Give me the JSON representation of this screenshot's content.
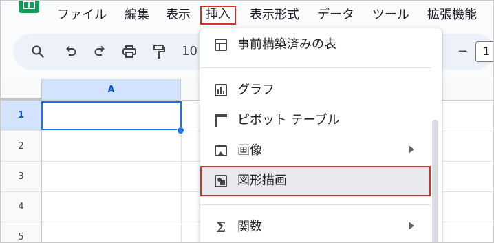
{
  "menubar": {
    "items": [
      "ファイル",
      "編集",
      "表示",
      "挿入",
      "表示形式",
      "データ",
      "ツール",
      "拡張機能"
    ],
    "active_index": 3
  },
  "toolbar": {
    "icons": [
      "search-icon",
      "undo-icon",
      "redo-icon",
      "print-icon",
      "paint-format-icon"
    ],
    "zoom_text": "10",
    "minus": "−",
    "font_size_partial": "1"
  },
  "grid": {
    "column_header": "A",
    "rows": [
      "1",
      "2",
      "3",
      "4",
      "5"
    ],
    "selected_row": "1"
  },
  "insert_menu": {
    "items": [
      {
        "label": "事前構築済みの表",
        "icon": "table-icon",
        "submenu": false
      },
      {
        "label": "グラフ",
        "icon": "chart-icon",
        "submenu": false
      },
      {
        "label": "ピボット テーブル",
        "icon": "pivot-table-icon",
        "submenu": false
      },
      {
        "label": "画像",
        "icon": "image-icon",
        "submenu": true
      },
      {
        "label": "図形描画",
        "icon": "drawing-icon",
        "submenu": false,
        "highlighted": true
      },
      {
        "label": "関数",
        "icon": "sigma-icon",
        "submenu": true
      }
    ]
  },
  "colors": {
    "highlight_border": "#d93025",
    "selection_blue": "#1a73e8",
    "header_selected": "#d3e3fd",
    "sheets_green": "#0f9d58"
  }
}
